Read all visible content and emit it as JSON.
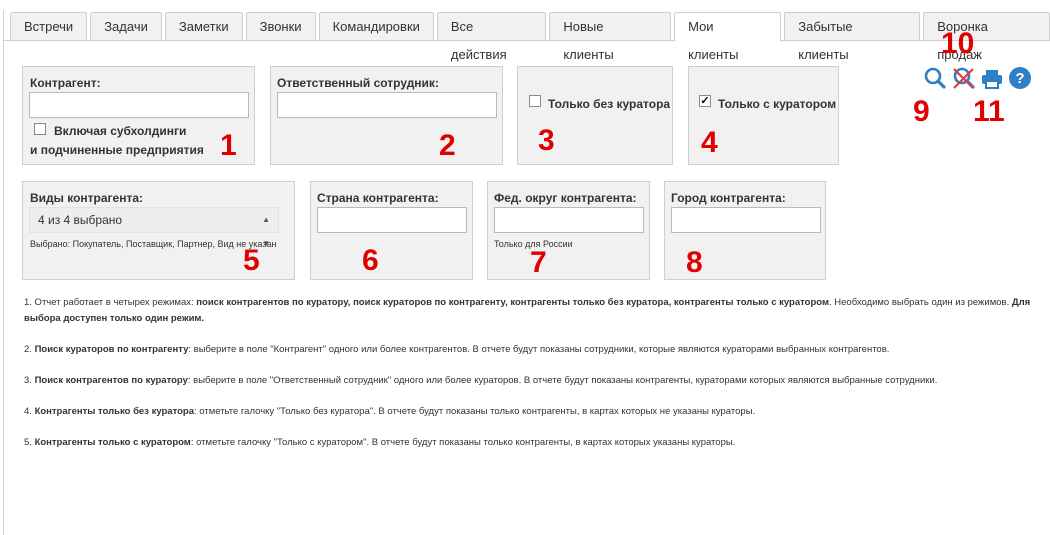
{
  "tabs": [
    {
      "label": "Встречи"
    },
    {
      "label": "Задачи"
    },
    {
      "label": "Заметки"
    },
    {
      "label": "Звонки"
    },
    {
      "label": "Командировки"
    },
    {
      "label": "Все действия"
    },
    {
      "label": "Новые клиенты"
    },
    {
      "label": "Мои клиенты",
      "active": true
    },
    {
      "label": "Забытые клиенты"
    },
    {
      "label": "Воронка продаж"
    }
  ],
  "filters": {
    "counterparty": {
      "label": "Контрагент:",
      "value": "",
      "include_line1": "Включая субхолдинги",
      "include_line2": "и подчиненные предприятия",
      "include_checked": false
    },
    "responsible": {
      "label": "Ответственный сотрудник:",
      "value": ""
    },
    "without_curator": {
      "label": "Только без куратора",
      "checked": false
    },
    "with_curator": {
      "label": "Только с куратором",
      "checked": true
    },
    "types": {
      "label": "Виды контрагента:",
      "selected": "4 из 4 выбрано",
      "hint": "Выбрано: Покупатель, Поставщик, Партнер, Вид не указан"
    },
    "country": {
      "label": "Страна контрагента:",
      "value": ""
    },
    "fed_district": {
      "label": "Фед. округ контрагента:",
      "value": "",
      "hint": "Только для России"
    },
    "city": {
      "label": "Город контрагента:",
      "value": ""
    }
  },
  "annotations": [
    "1",
    "2",
    "3",
    "4",
    "5",
    "6",
    "7",
    "8",
    "9",
    "10",
    "11"
  ],
  "toolbar_icons": [
    "search-icon",
    "clear-filter-icon",
    "print-icon",
    "help-icon"
  ],
  "colors": {
    "annotation": "#e00000",
    "icon_blue": "#2f7fc8",
    "icon_red": "#e03b3b"
  },
  "notes": {
    "n1": {
      "a": "1. Отчет работает в четырех режимах: ",
      "b": "поиск контрагентов по куратору, поиск кураторов по контрагенту, контрагенты только без куратора, контрагенты только с куратором",
      "c": ". Необходимо выбрать один из режимов. ",
      "d": "Для выбора доступен только один режим."
    },
    "n2": {
      "num": "2. ",
      "bold": "Поиск кураторов по контрагенту",
      "text": ": выберите в поле \"Контрагент\" одного или более контрагентов. В отчете будут показаны сотрудники, которые являются кураторами выбранных контрагентов."
    },
    "n3": {
      "num": "3. ",
      "bold": "Поиск контрагентов по куратору",
      "text": ": выберите в поле \"Ответственный сотрудник\" одного или более кураторов. В отчете будут показаны контрагенты, кураторами которых являются выбранные сотрудники."
    },
    "n4": {
      "num": "4. ",
      "bold": "Контрагенты только без куратора",
      "text": ": отметьте галочку \"Только без куратора\". В отчете будут показаны только контрагенты, в картах которых не указаны кураторы."
    },
    "n5": {
      "num": "5. ",
      "bold": "Контрагенты только с куратором",
      "text": ": отметьте галочку \"Только с куратором\". В отчете будут показаны только контрагенты, в картах которых указаны кураторы."
    }
  }
}
